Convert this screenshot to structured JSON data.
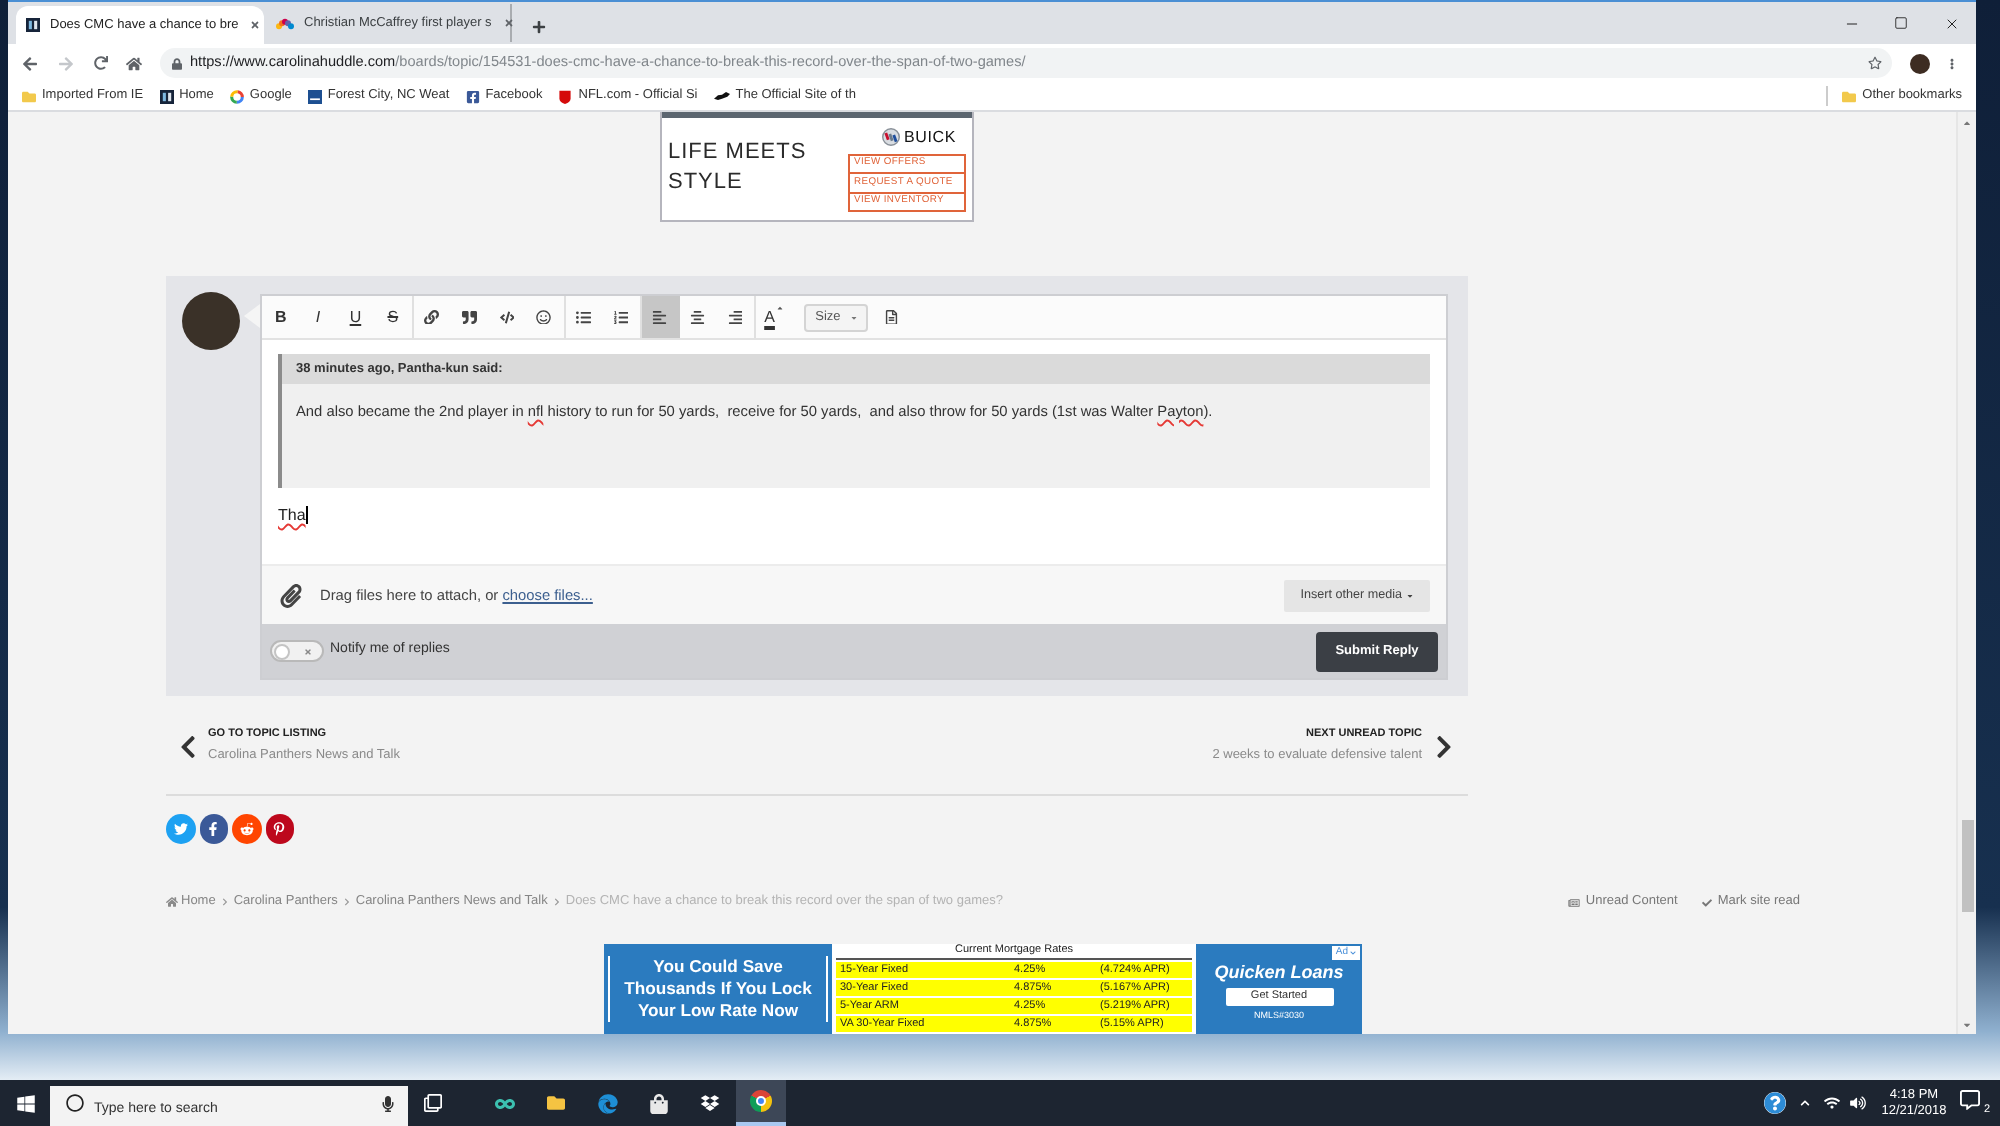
{
  "browser": {
    "tabs": [
      {
        "kind": "site",
        "title": "Does CMC have a chance to bre",
        "selected": true
      },
      {
        "kind": "peacock",
        "title": "Christian McCaffrey first player s",
        "selected": false
      }
    ],
    "nav_buttons": [
      {
        "kind": "back",
        "disabled": false
      },
      {
        "kind": "forward",
        "disabled": true
      },
      {
        "kind": "reload",
        "disabled": false
      },
      {
        "kind": "home",
        "disabled": false
      }
    ],
    "address": {
      "host": "https://www.carolinahuddle.com",
      "path": "/boards/topic/154531-does-cmc-have-a-chance-to-break-this-record-over-the-span-of-two-games/"
    },
    "bookmarks": [
      {
        "kind": "folder",
        "label": "Imported From IE"
      },
      {
        "kind": "site",
        "label": "Home"
      },
      {
        "kind": "google",
        "label": "Google"
      },
      {
        "kind": "weather",
        "label": "Forest City, NC Weat"
      },
      {
        "kind": "facebook",
        "label": "Facebook"
      },
      {
        "kind": "nfl",
        "label": "NFL.com - Official Si"
      },
      {
        "kind": "panther",
        "label": "The Official Site of th"
      }
    ],
    "other_bookmarks": "Other bookmarks"
  },
  "top_ad": {
    "headline": "LIFE MEETS STYLE",
    "brand": "BUICK",
    "links": [
      "VIEW OFFERS",
      "REQUEST A QUOTE",
      "VIEW INVENTORY"
    ]
  },
  "editor": {
    "toolbar": [
      [
        {
          "kind": "bold",
          "label": "B",
          "selected": false
        },
        {
          "kind": "italic",
          "label": "I",
          "selected": false
        },
        {
          "kind": "underline",
          "label": "U",
          "selected": false
        },
        {
          "kind": "strike",
          "label": "S",
          "selected": false
        }
      ],
      [
        {
          "kind": "link",
          "selected": false
        },
        {
          "kind": "quote",
          "selected": false
        },
        {
          "kind": "code",
          "selected": false
        },
        {
          "kind": "emoji",
          "selected": false
        }
      ],
      [
        {
          "kind": "bullets",
          "selected": false
        },
        {
          "kind": "numbers",
          "selected": false
        }
      ],
      [
        {
          "kind": "align-left",
          "selected": true
        },
        {
          "kind": "align-center",
          "selected": false
        },
        {
          "kind": "align-right",
          "selected": false
        }
      ],
      [
        {
          "kind": "text-color",
          "label": "A",
          "selected": false
        },
        {
          "kind": "size",
          "label": "Size"
        },
        {
          "kind": "preview",
          "selected": false
        }
      ]
    ],
    "quote": {
      "citation": "38 minutes ago, Pantha-kun said:",
      "body": [
        {
          "text": "And also became the 2nd player in ",
          "misspelled": false
        },
        {
          "text": "nfl",
          "misspelled": true
        },
        {
          "text": " history to run for 50 yards,  receive for 50 yards,  and also throw for 50 yards (1st was Walter ",
          "misspelled": false
        },
        {
          "text": "Payton",
          "misspelled": true
        },
        {
          "text": ").",
          "misspelled": false
        }
      ]
    },
    "draft": [
      {
        "text": "Tha",
        "misspelled": true
      }
    ],
    "attach": {
      "prompt": "Drag files here to attach, or",
      "link": "choose files...",
      "media_button": "Insert other media"
    },
    "notify": {
      "label": "Notify me of replies",
      "on": false
    },
    "submit": "Submit Reply"
  },
  "topic_nav": {
    "previous": {
      "heading": "GO TO TOPIC LISTING",
      "title": "Carolina Panthers News and Talk"
    },
    "next": {
      "heading": "NEXT UNREAD TOPIC",
      "title": "2 weeks to evaluate defensive talent"
    }
  },
  "share": [
    {
      "kind": "twitter",
      "color": "#1da1f2"
    },
    {
      "kind": "facebook",
      "color": "#3b5998"
    },
    {
      "kind": "reddit",
      "color": "#ff4500"
    },
    {
      "kind": "pinterest",
      "color": "#bd081c"
    }
  ],
  "breadcrumb": {
    "items": [
      "Home",
      "Carolina Panthers",
      "Carolina Panthers News and Talk",
      "Does CMC have a chance to break this record over the span of two games?"
    ],
    "actions": [
      {
        "kind": "unread",
        "label": "Unread Content"
      },
      {
        "kind": "mark-read",
        "label": "Mark site read"
      }
    ]
  },
  "bottom_ad": {
    "headline": "You Could Save Thousands If You Lock Your Low Rate Now",
    "table_title": "Current Mortgage Rates",
    "rates": [
      {
        "term": "15-Year Fixed",
        "rate": "4.25%",
        "apr": "(4.724% APR)"
      },
      {
        "term": "30-Year Fixed",
        "rate": "4.875%",
        "apr": "(5.167% APR)"
      },
      {
        "term": "5-Year ARM",
        "rate": "4.25%",
        "apr": "(5.219% APR)"
      },
      {
        "term": "VA 30-Year Fixed",
        "rate": "4.875%",
        "apr": "(5.15% APR)"
      }
    ],
    "brand": "Quicken Loans",
    "cta": "Get Started",
    "license": "NMLS#3030",
    "badge": "Ad"
  },
  "taskbar": {
    "search_placeholder": "Type here to search",
    "apps": [
      {
        "kind": "infinity",
        "selected": false
      },
      {
        "kind": "explorer",
        "selected": false
      },
      {
        "kind": "edge",
        "selected": false
      },
      {
        "kind": "store",
        "selected": false
      },
      {
        "kind": "dropbox",
        "selected": false
      },
      {
        "kind": "chrome",
        "selected": true
      }
    ],
    "time": "4:18 PM",
    "date": "12/21/2018",
    "notifications": "2"
  }
}
